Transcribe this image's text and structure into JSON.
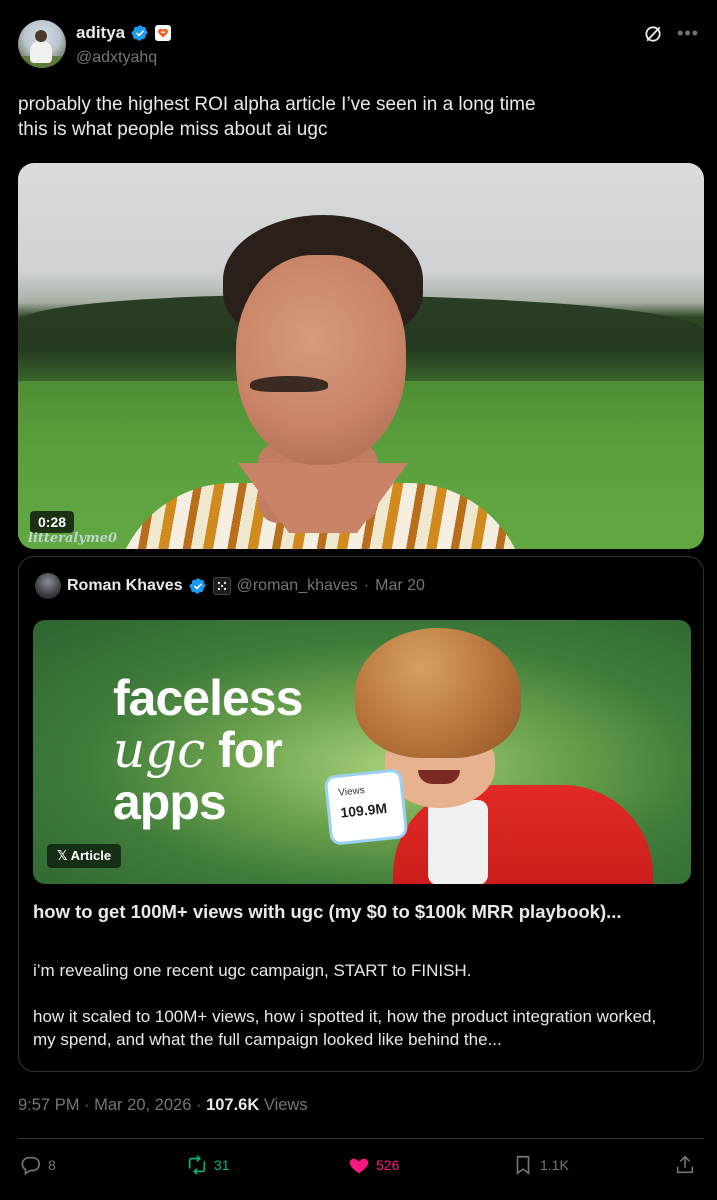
{
  "author": {
    "name": "aditya",
    "handle": "@adxtyahq",
    "verified_color": "#1d9bf0"
  },
  "tweet": {
    "line1": "probably the highest ROI alpha article I’ve seen in a long time",
    "line2": "this is what people miss about ai ugc"
  },
  "video": {
    "duration": "0:28",
    "watermark": "litteralyme0"
  },
  "quoted": {
    "name": "Roman Khaves",
    "handle": "@roman_khaves",
    "date": "Mar 20",
    "image": {
      "headline_line1": "faceless",
      "headline_word_italic": "ugc",
      "headline_word": "for",
      "headline_line3": "apps",
      "views_label": "Views",
      "views_value": "109.9M",
      "badge": "𝕏 Article"
    },
    "title": "how to get 100M+ views with ugc (my $0 to $100k MRR playbook)...",
    "body_p1": "i’m revealing one recent ugc campaign, START to FINISH.",
    "body_p2": "how it scaled to 100M+ views, how i spotted it, how the product integration worked, my spend, and what the full campaign looked like behind the..."
  },
  "meta": {
    "time": "9:57 PM",
    "date": "Mar 20, 2026",
    "views_count": "107.6K",
    "views_label": "Views"
  },
  "actions": {
    "replies": "8",
    "reposts": "31",
    "likes": "526",
    "bookmarks": "1.1K"
  },
  "colors": {
    "background": "#000000",
    "text": "#e7e9ea",
    "secondary": "#71767b",
    "repost": "#00ba7c",
    "like": "#f91880",
    "accent": "#1d9bf0"
  }
}
